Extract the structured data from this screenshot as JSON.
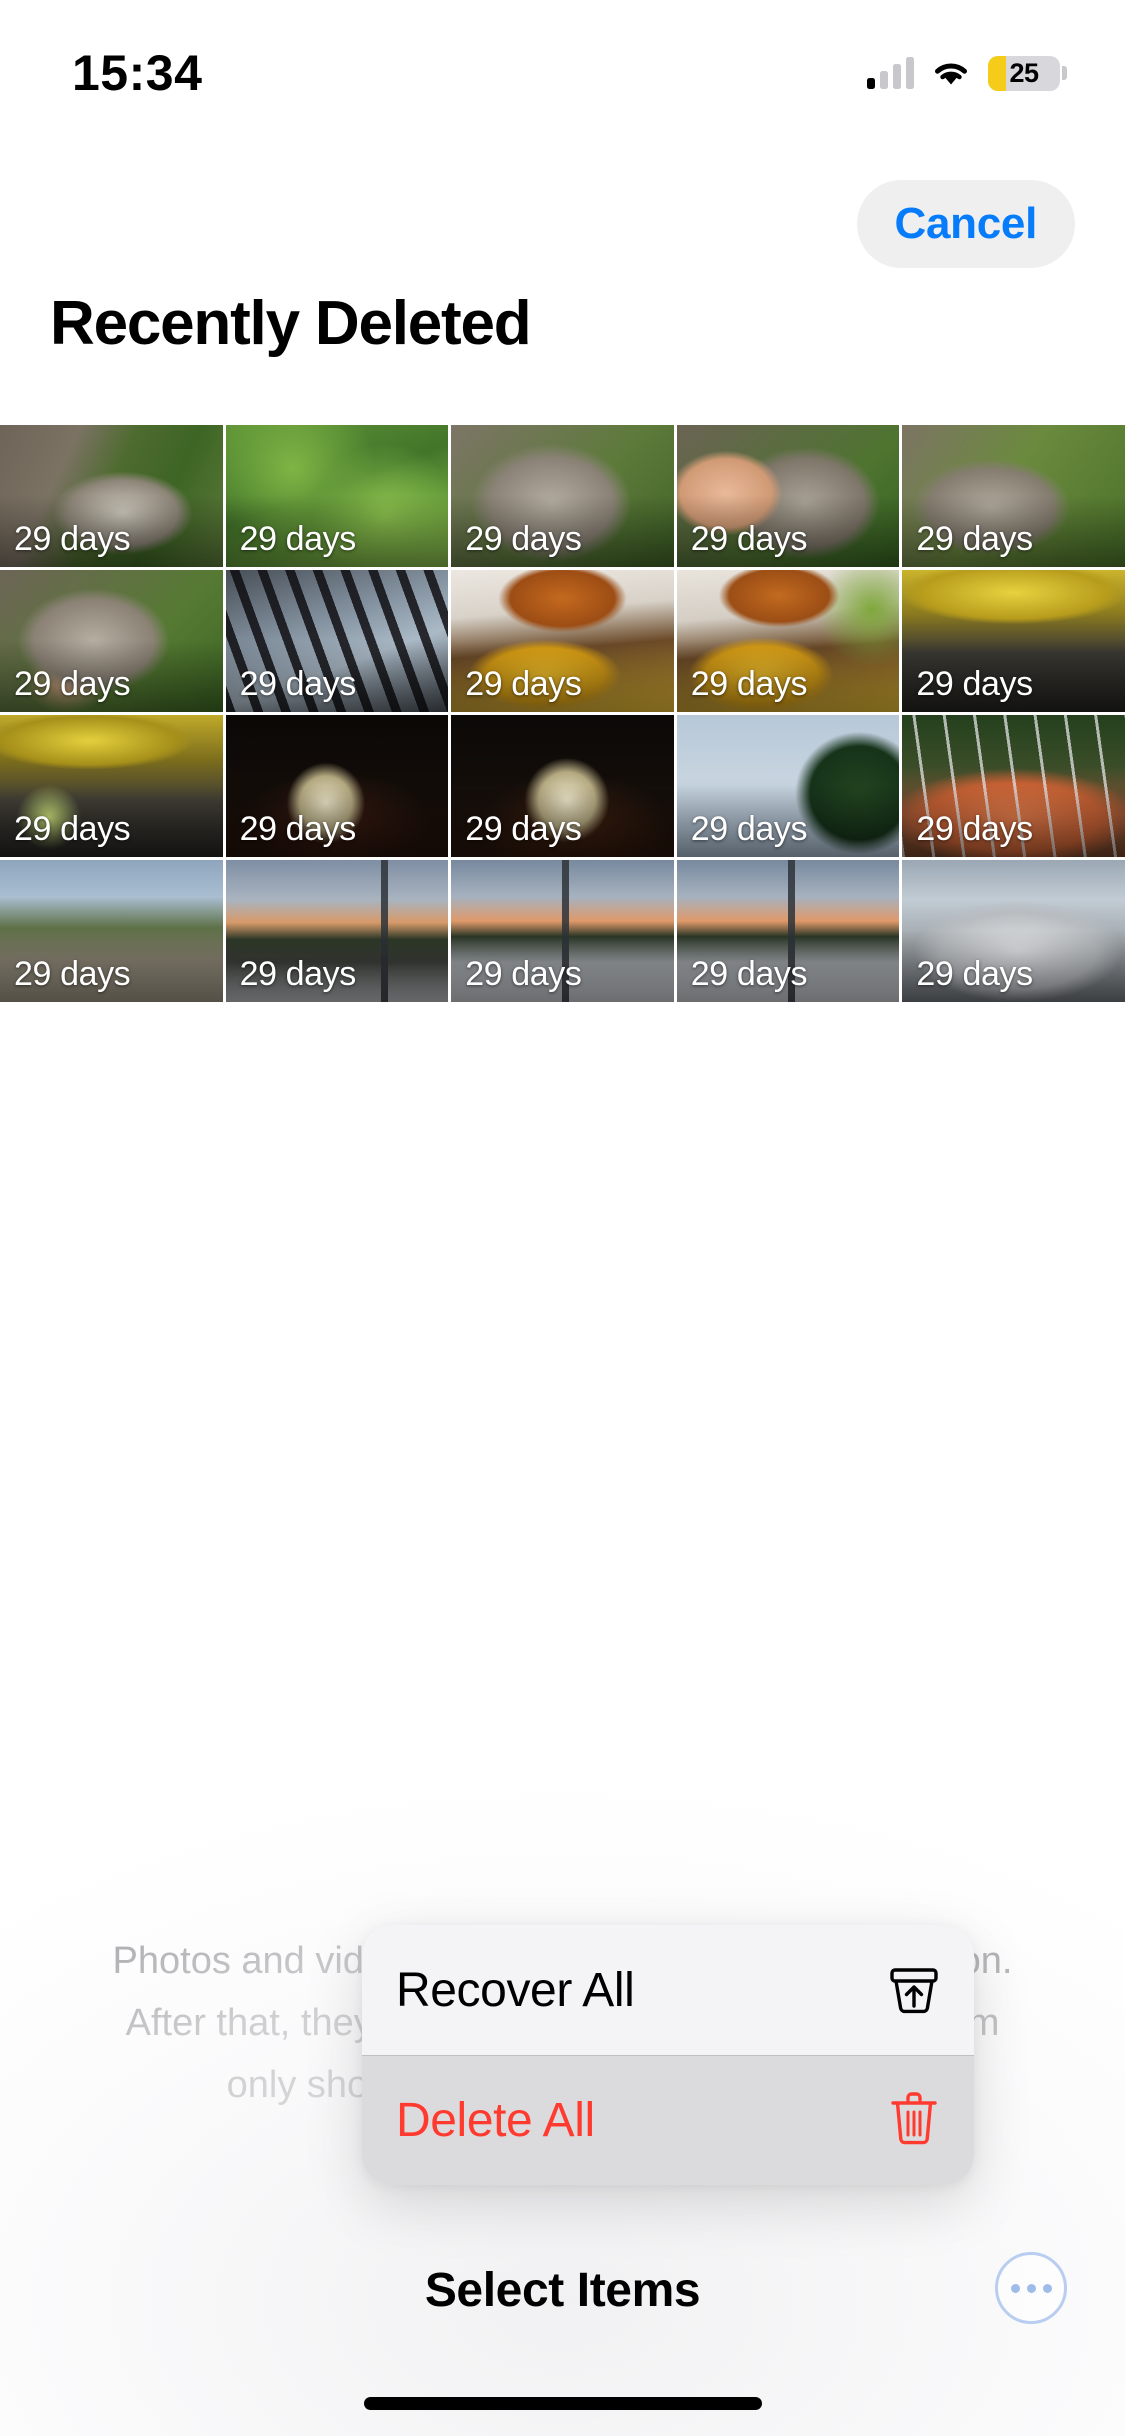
{
  "status_bar": {
    "time": "15:34",
    "battery_percent": "25",
    "battery_low_power": true,
    "icons": [
      "cellular-signal-icon",
      "wifi-icon",
      "battery-icon"
    ]
  },
  "nav": {
    "cancel_label": "Cancel",
    "title": "Recently Deleted"
  },
  "grid": {
    "days_label": "29 days",
    "tiles": [
      {
        "art": "art-cat-path",
        "days": "29 days",
        "alt": "cat-on-stone-path"
      },
      {
        "art": "art-green-garden",
        "days": "29 days",
        "alt": "green-garden-plants"
      },
      {
        "art": "art-cat-face",
        "days": "29 days",
        "alt": "grey-fluffy-cat"
      },
      {
        "art": "art-cat-hand",
        "days": "29 days",
        "alt": "hand-petting-cat"
      },
      {
        "art": "art-cat-grass",
        "days": "29 days",
        "alt": "cat-in-grass"
      },
      {
        "art": "art-cat-chin",
        "days": "29 days",
        "alt": "cat-being-scratched"
      },
      {
        "art": "art-pergola",
        "days": "29 days",
        "alt": "pergola-roof-sky"
      },
      {
        "art": "art-burger",
        "days": "29 days",
        "alt": "burger-and-fries"
      },
      {
        "art": "art-burger2",
        "days": "29 days",
        "alt": "burger-and-fries-second"
      },
      {
        "art": "art-bar",
        "days": "29 days",
        "alt": "restaurant-bar-interior"
      },
      {
        "art": "art-bar2",
        "days": "29 days",
        "alt": "bar-table-with-drink"
      },
      {
        "art": "art-lantern",
        "days": "29 days",
        "alt": "glass-lantern-dark"
      },
      {
        "art": "art-lantern2",
        "days": "29 days",
        "alt": "glass-lantern-dark-second"
      },
      {
        "art": "art-sky-tree",
        "days": "29 days",
        "alt": "cloudy-sky-with-tree"
      },
      {
        "art": "art-kebab",
        "days": "29 days",
        "alt": "grilled-meat-skewers"
      },
      {
        "art": "art-road-person",
        "days": "29 days",
        "alt": "person-on-path-evening"
      },
      {
        "art": "art-sunset-car",
        "days": "29 days",
        "alt": "sunset-with-silver-car"
      },
      {
        "art": "art-sunset-car2",
        "days": "29 days",
        "alt": "sunset-car-and-person"
      },
      {
        "art": "art-sunset-car2",
        "days": "29 days",
        "alt": "sunset-car-and-person-second"
      },
      {
        "art": "art-bmw",
        "days": "29 days",
        "alt": "white-bmw-car"
      }
    ]
  },
  "empty_description": "Photos and videos are kept for 30 days after deletion. After that, they are permanently deleted. This album only shows media stored on this device.",
  "context_menu": {
    "items": [
      {
        "label": "Recover All",
        "icon": "recover-trash-up-arrow-icon",
        "destructive": false,
        "pressed": false
      },
      {
        "label": "Delete All",
        "icon": "trash-icon",
        "destructive": true,
        "pressed": true
      }
    ]
  },
  "toolbar": {
    "select_items_label": "Select Items",
    "more_icon": "ellipsis-circle-icon"
  },
  "colors": {
    "accent_blue": "#067cfb",
    "destructive_red": "#ff3b30",
    "battery_yellow": "#f6cc1b",
    "menu_background": "#f4f4f6",
    "menu_pressed": "#dbdbdd"
  }
}
